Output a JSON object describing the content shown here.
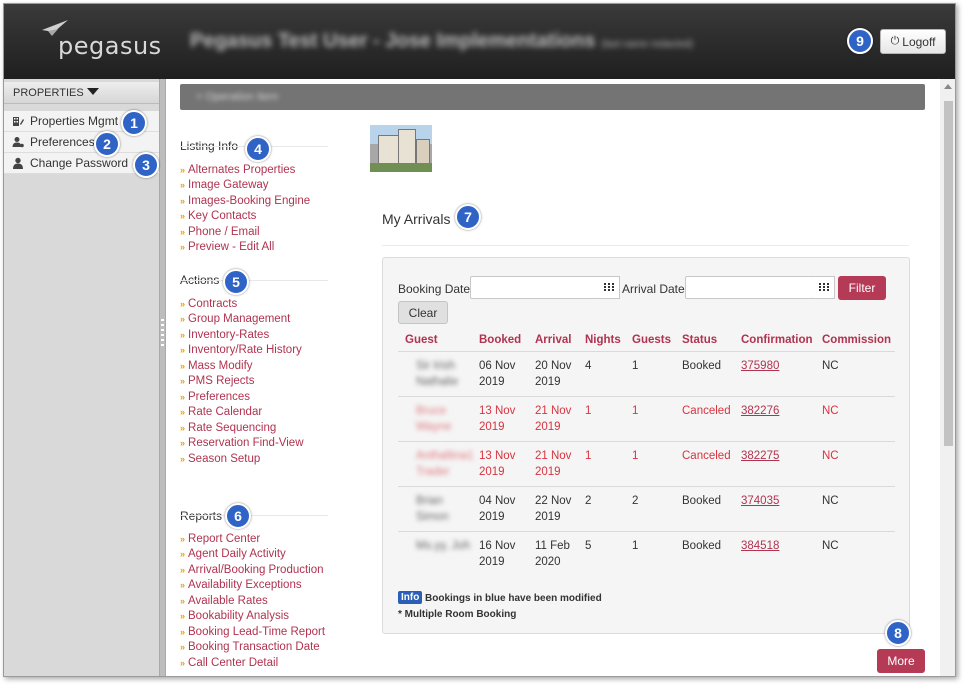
{
  "header": {
    "logo_text": "pegasus",
    "user_title": "Pegasus Test User - Jose Implementations",
    "user_subtitle": "(last name redacted)",
    "logoff_label": "Logoff"
  },
  "badges": [
    "1",
    "2",
    "3",
    "4",
    "5",
    "6",
    "7",
    "8",
    "9"
  ],
  "sidebar": {
    "heading": "PROPERTIES",
    "items": [
      {
        "label": "Properties Mgmt",
        "icon": "building-edit-icon"
      },
      {
        "label": "Preferences",
        "icon": "user-gear-icon"
      },
      {
        "label": "Change Password",
        "icon": "user-icon"
      }
    ]
  },
  "breadcrumb": "> Operation Item",
  "listing_info": {
    "title": "Listing Info",
    "links": [
      "Alternates Properties",
      "Image Gateway",
      "Images-Booking Engine",
      "Key Contacts",
      "Phone / Email",
      "Preview - Edit All"
    ]
  },
  "actions": {
    "title": "Actions",
    "links": [
      "Contracts",
      "Group Management",
      "Inventory-Rates",
      "Inventory/Rate History",
      "Mass Modify",
      "PMS Rejects",
      "Preferences",
      "Rate Calendar",
      "Rate Sequencing",
      "Reservation Find-View",
      "Season Setup"
    ]
  },
  "reports": {
    "title": "Reports",
    "links": [
      "Report Center",
      "Agent Daily Activity",
      "Arrival/Booking Production",
      "Availability Exceptions",
      "Available Rates",
      "Bookability Analysis",
      "Booking Lead-Time Report",
      "Booking Transaction Date",
      "Call Center Detail"
    ]
  },
  "arrivals": {
    "title": "My Arrivals",
    "booking_date_label": "Booking Date:",
    "arrival_date_label": "Arrival Date:",
    "booking_date_value": "",
    "arrival_date_value": "",
    "filter_label": "Filter",
    "clear_label": "Clear",
    "columns": [
      "Guest",
      "Booked",
      "Arrival",
      "Nights",
      "Guests",
      "Status",
      "Confirmation",
      "Commission"
    ],
    "rows": [
      {
        "guest": [
          "Sir Irish",
          "Nathalie"
        ],
        "booked": [
          "06 Nov",
          "2019"
        ],
        "arrival": [
          "20 Nov",
          "2019"
        ],
        "nights": "4",
        "guests": "1",
        "status": "Booked",
        "confirmation": "375980",
        "commission": "NC",
        "canceled": false
      },
      {
        "guest": [
          "Bruce",
          "Wayne"
        ],
        "booked": [
          "13 Nov",
          "2019"
        ],
        "arrival": [
          "21 Nov",
          "2019"
        ],
        "nights": "1",
        "guests": "1",
        "status": "Canceled",
        "confirmation": "382276",
        "commission": "NC",
        "canceled": true
      },
      {
        "guest": [
          "Anthaltina1",
          "Trader"
        ],
        "booked": [
          "13 Nov",
          "2019"
        ],
        "arrival": [
          "21 Nov",
          "2019"
        ],
        "nights": "1",
        "guests": "1",
        "status": "Canceled",
        "confirmation": "382275",
        "commission": "NC",
        "canceled": true
      },
      {
        "guest": [
          "Brian",
          "Simon"
        ],
        "booked": [
          "04 Nov",
          "2019"
        ],
        "arrival": [
          "22 Nov",
          "2019"
        ],
        "nights": "2",
        "guests": "2",
        "status": "Booked",
        "confirmation": "374035",
        "commission": "NC",
        "canceled": false
      },
      {
        "guest": [
          "Ms.yy, Joh",
          ""
        ],
        "booked": [
          "16 Nov",
          "2019"
        ],
        "arrival": [
          "11 Feb",
          "2020"
        ],
        "nights": "5",
        "guests": "1",
        "status": "Booked",
        "confirmation": "384518",
        "commission": "NC",
        "canceled": false
      }
    ],
    "info_badge": "Info",
    "info_note": "Bookings in blue have been modified",
    "multi_note": "* Multiple Room Booking",
    "more_label": "More"
  },
  "colors": {
    "accent": "#b53a56",
    "link": "#b0334f",
    "badge": "#2f63c6",
    "arrow": "#e8a200"
  }
}
